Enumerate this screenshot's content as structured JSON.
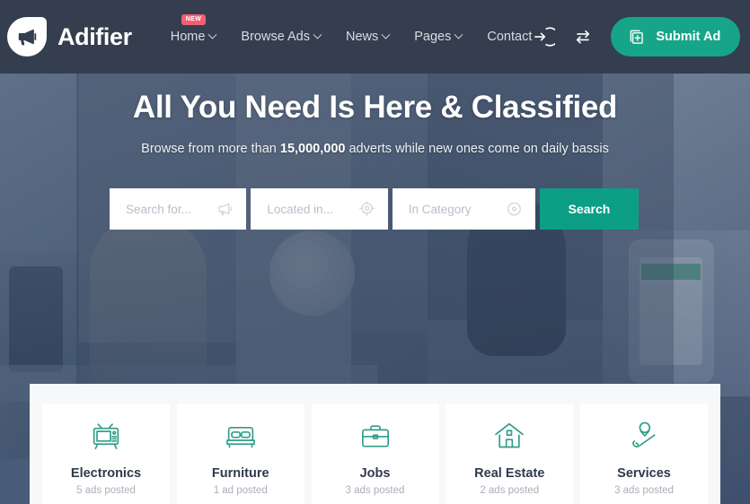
{
  "brand": {
    "name": "Adifier",
    "logo_icon": "megaphone-icon",
    "accent_color": "#17a589",
    "header_color": "#343e4e"
  },
  "nav": {
    "items": [
      {
        "label": "Home",
        "has_caret": true,
        "badge": "NEW"
      },
      {
        "label": "Browse Ads",
        "has_caret": true,
        "badge": ""
      },
      {
        "label": "News",
        "has_caret": true,
        "badge": ""
      },
      {
        "label": "Pages",
        "has_caret": true,
        "badge": ""
      },
      {
        "label": "Contact",
        "has_caret": false,
        "badge": ""
      }
    ]
  },
  "header_actions": {
    "login_icon": "login-arrow-icon",
    "compare_icon": "compare-arrows-icon",
    "submit_ad": {
      "label": "Submit Ad",
      "icon": "add-document-icon",
      "color": "#17a589"
    }
  },
  "hero": {
    "title": "All You Need Is Here & Classified",
    "subtitle_before": "Browse from more than ",
    "subtitle_highlight": "15,000,000",
    "subtitle_after": " adverts while new ones come on daily bassis"
  },
  "search": {
    "fields": [
      {
        "placeholder": "Search for...",
        "value": "",
        "icon": "megaphone-icon"
      },
      {
        "placeholder": "Located in...",
        "value": "",
        "icon": "location-pin-icon"
      },
      {
        "placeholder": "In Category",
        "value": "",
        "icon": "category-target-icon"
      }
    ],
    "button_label": "Search",
    "button_color": "#0d9e86"
  },
  "categories": {
    "items": [
      {
        "name": "Electronics",
        "count": "5 ads posted",
        "icon": "tv-icon"
      },
      {
        "name": "Furniture",
        "count": "1 ad posted",
        "icon": "bed-icon"
      },
      {
        "name": "Jobs",
        "count": "3 ads posted",
        "icon": "briefcase-icon"
      },
      {
        "name": "Real Estate",
        "count": "2 ads posted",
        "icon": "house-icon"
      },
      {
        "name": "Services",
        "count": "3 ads posted",
        "icon": "service-hand-icon"
      }
    ],
    "icon_color": "#2e9e88"
  }
}
